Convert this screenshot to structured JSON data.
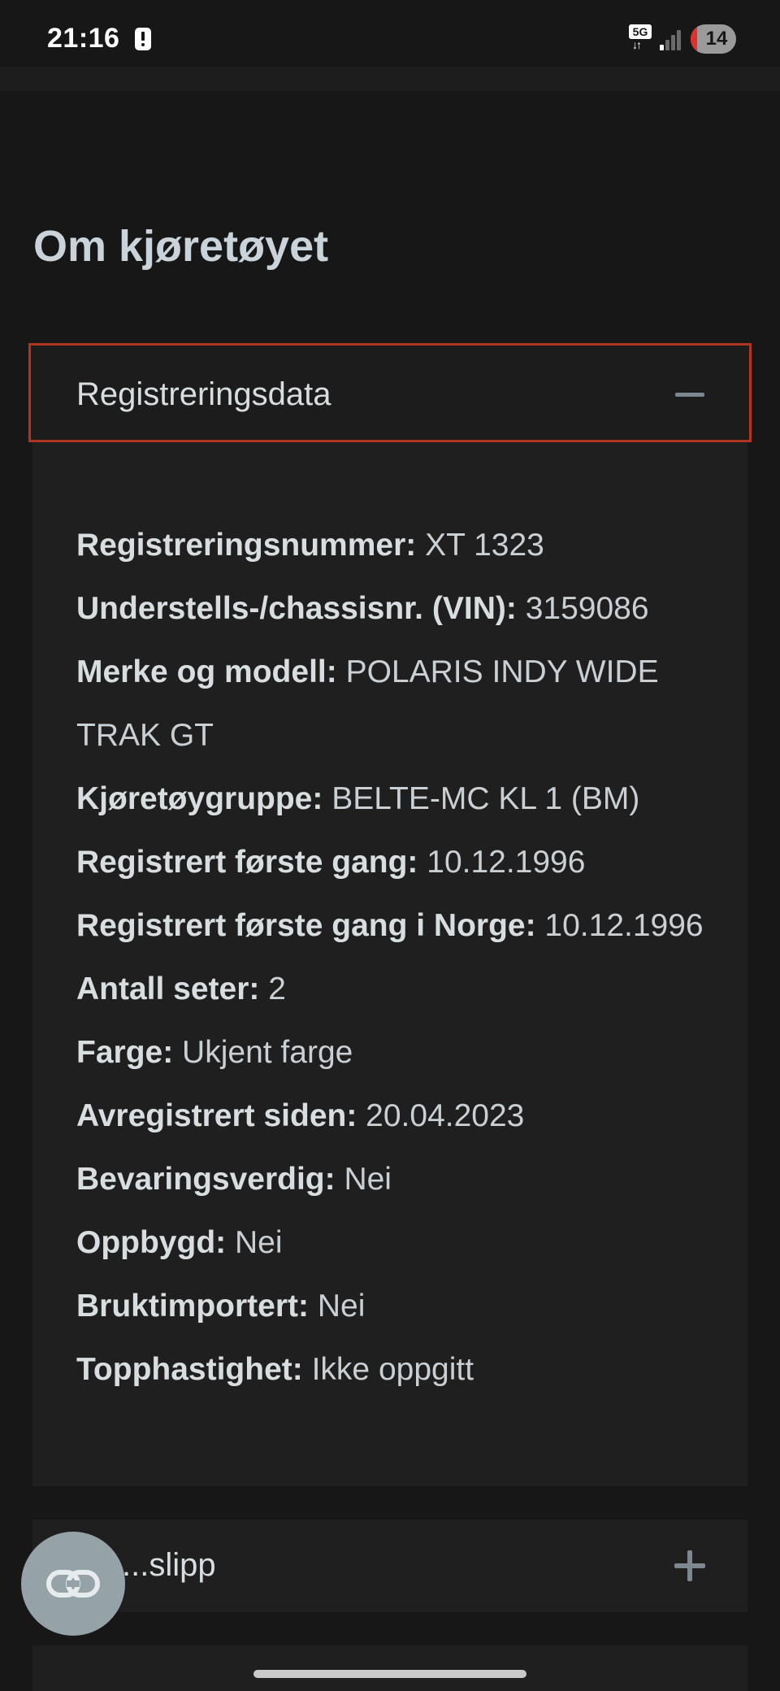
{
  "status_bar": {
    "time": "21:16",
    "network": "5G",
    "network_arrows": "↓↑",
    "battery_level": "14",
    "battery_fraction": 0.14,
    "signal_bars_filled": 1,
    "signal_bars_total": 4
  },
  "page": {
    "title": "Om kjøretøyet"
  },
  "registration": {
    "header": "Registreringsdata",
    "expanded": true,
    "fields": [
      {
        "label": "Registreringsnummer:",
        "value": "XT 1323"
      },
      {
        "label": "Understells-/chassisnr. (VIN):",
        "value": "3159086"
      },
      {
        "label": "Merke og modell:",
        "value": "POLARIS INDY WIDE TRAK GT"
      },
      {
        "label": "Kjøretøygruppe:",
        "value": "BELTE-MC KL 1 (BM)"
      },
      {
        "label": "Registrert første gang:",
        "value": "10.12.1996"
      },
      {
        "label": "Registrert første gang i Norge:",
        "value": "10.12.1996"
      },
      {
        "label": "Antall seter:",
        "value": "2"
      },
      {
        "label": "Farge:",
        "value": "Ukjent farge"
      },
      {
        "label": "Avregistrert siden:",
        "value": "20.04.2023"
      },
      {
        "label": "Bevaringsverdig:",
        "value": "Nei"
      },
      {
        "label": "Oppbygd:",
        "value": "Nei"
      },
      {
        "label": "Bruktimportert:",
        "value": "Nei"
      },
      {
        "label": "Topphastighet:",
        "value": "Ikke oppgitt"
      }
    ]
  },
  "section2": {
    "header": "...slipp",
    "expanded": false
  },
  "fab": {
    "icon": "link-icon"
  },
  "colors": {
    "background": "#171717",
    "panel": "#1f1f1f",
    "focus_border": "#b0341f",
    "text": "#d8dde0",
    "title": "#c9d3d9",
    "icon_muted": "#7d8790",
    "fab": "#95a2a8",
    "battery_low": "#e0302c"
  }
}
